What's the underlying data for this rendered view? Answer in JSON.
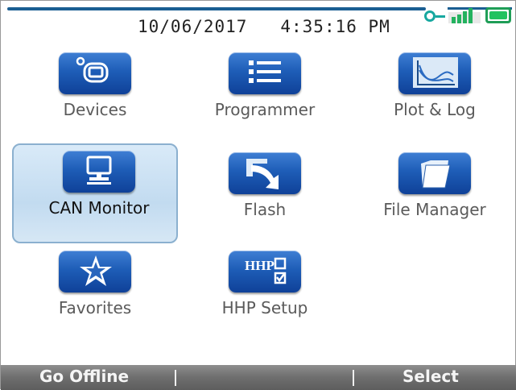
{
  "status": {
    "date": "10/06/2017",
    "time": "4:35:16 PM"
  },
  "apps": [
    {
      "label": "Devices",
      "icon": "devices-icon"
    },
    {
      "label": "Programmer",
      "icon": "list-icon"
    },
    {
      "label": "Plot & Log",
      "icon": "plot-icon"
    },
    {
      "label": "CAN Monitor",
      "icon": "monitor-icon",
      "selected": true
    },
    {
      "label": "Flash",
      "icon": "flash-arrow-icon"
    },
    {
      "label": "File Manager",
      "icon": "folder-icon"
    },
    {
      "label": "Favorites",
      "icon": "star-icon"
    },
    {
      "label": "HHP Setup",
      "icon": "hhp-checklist-icon"
    }
  ],
  "hhp_icon_text": "HHP",
  "softkeys": {
    "left": "Go Offline",
    "right": "Select"
  },
  "colors": {
    "accent": "#1a5e92",
    "icon_blue": "#1e5db7",
    "selection": "#c2dbf0",
    "softkey_bar": "#6e6e6e"
  }
}
